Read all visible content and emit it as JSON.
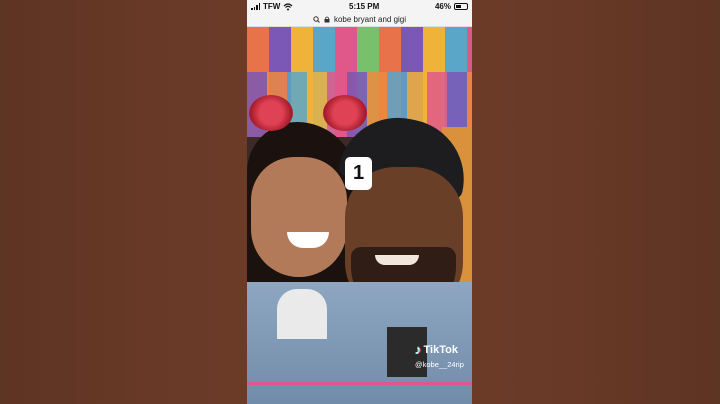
{
  "status_bar": {
    "carrier": "TFW",
    "time": "5:15 PM",
    "battery": "46%"
  },
  "url_bar": {
    "query": "kobe bryant and gigi"
  },
  "video": {
    "overlay_number": "1",
    "watermark_brand": "TikTok",
    "watermark_handle": "@kobe__24rip"
  },
  "icons": [
    "signal-icon",
    "wifi-icon",
    "battery-icon",
    "search-icon",
    "lock-icon",
    "tiktok-note-icon"
  ]
}
